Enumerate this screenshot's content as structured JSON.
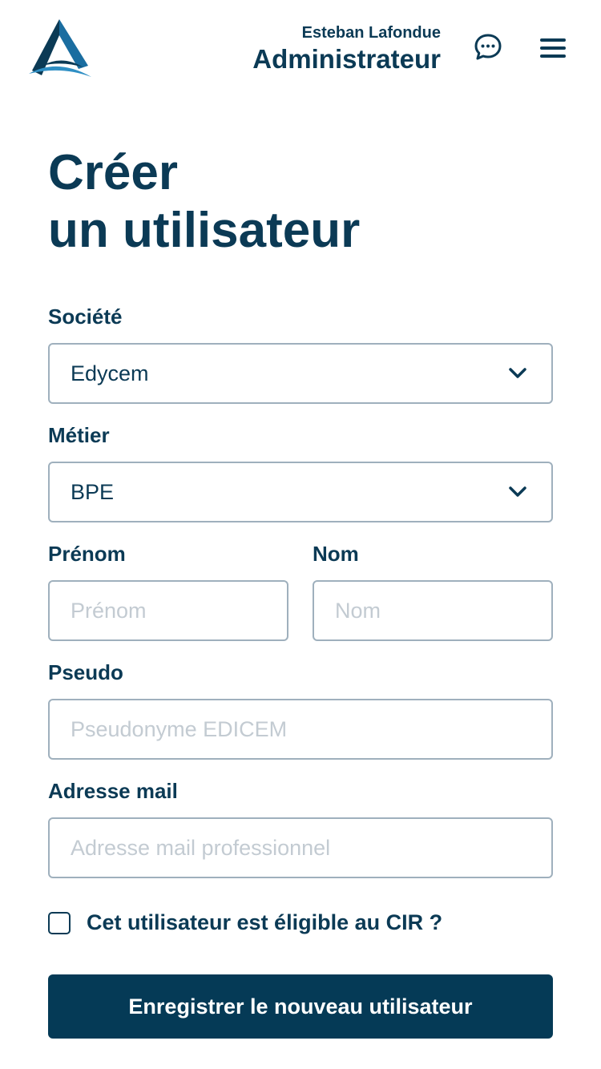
{
  "header": {
    "user_name": "Esteban Lafondue",
    "user_role": "Administrateur"
  },
  "page": {
    "title_line1": "Créer",
    "title_line2": "un utilisateur"
  },
  "form": {
    "societe": {
      "label": "Société",
      "value": "Edycem"
    },
    "metier": {
      "label": "Métier",
      "value": "BPE"
    },
    "prenom": {
      "label": "Prénom",
      "placeholder": "Prénom"
    },
    "nom": {
      "label": "Nom",
      "placeholder": "Nom"
    },
    "pseudo": {
      "label": "Pseudo",
      "placeholder": "Pseudonyme EDICEM"
    },
    "email": {
      "label": "Adresse mail",
      "placeholder": "Adresse mail professionnel"
    },
    "cir_checkbox_label": "Cet utilisateur est éligible au CIR ?",
    "submit_label": "Enregistrer le nouveau utilisateur"
  },
  "colors": {
    "primary": "#0b3a55",
    "button": "#053a56",
    "border": "#9fb0bd",
    "placeholder": "#c3cbd2"
  },
  "icons": [
    "logo-icon",
    "chat-icon",
    "hamburger-menu-icon",
    "chevron-down-icon"
  ]
}
